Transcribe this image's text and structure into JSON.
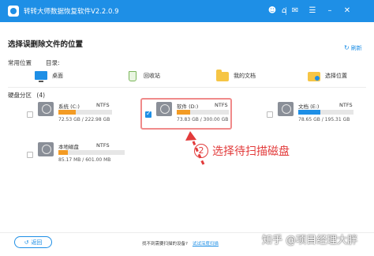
{
  "titlebar": {
    "title": "转转大师数据恢复软件V2.2.0.9",
    "icons": [
      "user-icon",
      "home-icon",
      "mail-icon",
      "menu-icon",
      "minimize-icon",
      "close-icon"
    ]
  },
  "heading": "选择误删除文件的位置",
  "refresh_label": "刷新",
  "common_locations": {
    "label": "常用位置",
    "dir_label": "目录:",
    "items": [
      {
        "label": "桌面",
        "icon": "desktop-icon"
      },
      {
        "label": "回收站",
        "icon": "recycle-bin-icon"
      },
      {
        "label": "我的文档",
        "icon": "documents-folder-icon"
      },
      {
        "label": "选择位置",
        "icon": "choose-location-icon"
      }
    ]
  },
  "partitions": {
    "label": "硬盘分区",
    "count": "(4)",
    "drives": [
      {
        "name": "系统 (C:)",
        "fs": "NTFS",
        "size": "72.53 GB / 222.98 GB",
        "used_fraction": 0.33,
        "fill_color": "#f39b24",
        "checked": false
      },
      {
        "name": "软件 (D:)",
        "fs": "NTFS",
        "size": "73.83 GB / 300.00 GB",
        "used_fraction": 0.25,
        "fill_color": "#f39b24",
        "checked": true
      },
      {
        "name": "文档 (E:)",
        "fs": "NTFS",
        "size": "78.65 GB / 195.31 GB",
        "used_fraction": 0.4,
        "fill_color": "#1e8fe6",
        "checked": false
      },
      {
        "name": "本地磁盘",
        "fs": "NTFS",
        "size": "85.17 MB / 601.00 MB",
        "used_fraction": 0.14,
        "fill_color": "#f39b24",
        "checked": false
      }
    ]
  },
  "annotation": {
    "number": "2",
    "text": "选择待扫描磁盘"
  },
  "footer": {
    "back_label": "返回",
    "hint": "找不到需要扫描的设备?",
    "link": "试试深度扫描"
  },
  "watermark": "知乎 @项目经理大胖",
  "colors": {
    "accent": "#1e8fe6",
    "highlight": "#f08a8a",
    "annotation": "#e23b3b"
  }
}
